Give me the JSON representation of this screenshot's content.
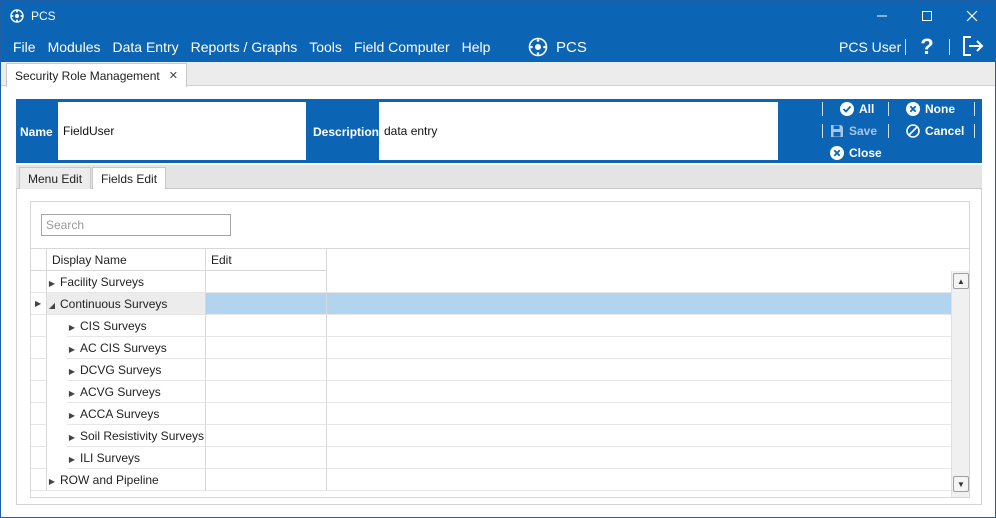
{
  "window": {
    "title": "PCS"
  },
  "menu": [
    "File",
    "Modules",
    "Data Entry",
    "Reports / Graphs",
    "Tools",
    "Field Computer",
    "Help"
  ],
  "brand": {
    "label": "PCS"
  },
  "user": {
    "name": "PCS User"
  },
  "help": {
    "glyph": "?"
  },
  "doc_tab": {
    "label": "Security Role Management",
    "close": "✕"
  },
  "header": {
    "name_label": "Name",
    "name_value": "FieldUser",
    "description_label": "Description",
    "description_value": "data entry",
    "actions": {
      "all": "All",
      "none": "None",
      "save": "Save",
      "cancel": "Cancel",
      "close": "Close"
    }
  },
  "subtabs": [
    "Menu Edit",
    "Fields Edit"
  ],
  "active_subtab": "Fields Edit",
  "search": {
    "placeholder": "Search",
    "value": ""
  },
  "grid": {
    "columns": [
      "Display Name",
      "Edit"
    ],
    "rows": [
      {
        "label": "Facility Surveys",
        "level": 0,
        "expanded": false,
        "selected": false
      },
      {
        "label": "Continuous Surveys",
        "level": 0,
        "expanded": true,
        "selected": true
      },
      {
        "label": "CIS Surveys",
        "level": 1,
        "expanded": false,
        "selected": false
      },
      {
        "label": "AC CIS Surveys",
        "level": 1,
        "expanded": false,
        "selected": false
      },
      {
        "label": "DCVG Surveys",
        "level": 1,
        "expanded": false,
        "selected": false
      },
      {
        "label": "ACVG Surveys",
        "level": 1,
        "expanded": false,
        "selected": false
      },
      {
        "label": "ACCA Surveys",
        "level": 1,
        "expanded": false,
        "selected": false
      },
      {
        "label": "Soil Resistivity Surveys",
        "level": 1,
        "expanded": false,
        "selected": false
      },
      {
        "label": "ILI Surveys",
        "level": 1,
        "expanded": false,
        "selected": false
      },
      {
        "label": "ROW and Pipeline",
        "level": 0,
        "expanded": false,
        "selected": false
      }
    ]
  },
  "colors": {
    "accent": "#0b64b4",
    "selection": "#b3d4ef"
  }
}
